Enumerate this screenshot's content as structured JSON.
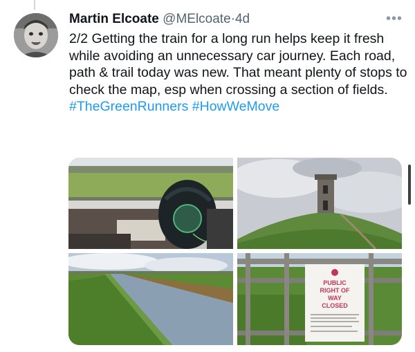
{
  "tweet": {
    "author_name": "Martin Elcoate",
    "handle": "@MElcoate",
    "separator": "·",
    "time": "4d",
    "more_icon": "more-horizontal-icon",
    "text": "2/2 Getting the train for a long run helps keep it fresh while avoiding an unnecessary car journey. Each road, path & trail today was new. That meant plenty of stops to check the map, esp when crossing a section of fields.",
    "hashtags": [
      "#TheGreenRunners",
      "#HowWeMove"
    ]
  },
  "media": {
    "photo_sign_text": [
      "PUBLIC",
      "RIGHT OF",
      "WAY",
      "CLOSED"
    ]
  },
  "colors": {
    "link": "#1d9bf0",
    "secondary_text": "#536471",
    "primary_text": "#0f1419"
  }
}
